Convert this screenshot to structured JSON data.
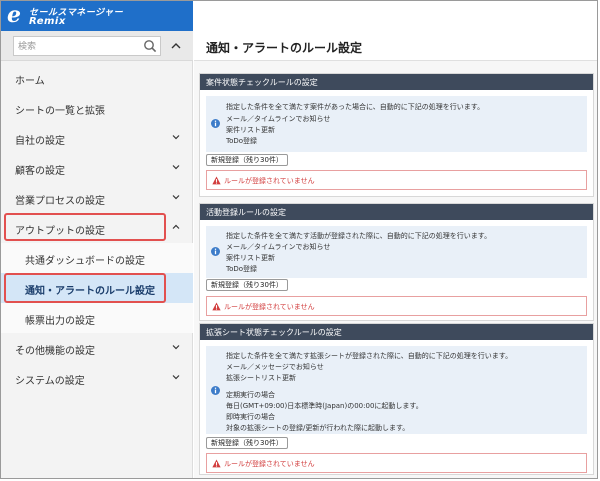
{
  "logo": {
    "line1": "セールスマネージャー",
    "line2": "Remix"
  },
  "search": {
    "placeholder": "検索"
  },
  "sidebar": {
    "items": [
      {
        "label": "ホーム"
      },
      {
        "label": "シートの一覧と拡張"
      },
      {
        "label": "自社の設定"
      },
      {
        "label": "顧客の設定"
      },
      {
        "label": "営業プロセスの設定"
      },
      {
        "label": "アウトプットの設定"
      },
      {
        "label": "共通ダッシュボードの設定"
      },
      {
        "label": "通知・アラートのルール設定"
      },
      {
        "label": "帳票出力の設定"
      },
      {
        "label": "その他機能の設定"
      },
      {
        "label": "システムの設定"
      }
    ]
  },
  "main": {
    "title": "通知・アラートのルール設定",
    "sections": [
      {
        "title": "案件状態チェックルールの設定",
        "lines": [
          "指定した条件を全て満たす案件があった場合に、自動的に下記の処理を行います。",
          "メール／タイムラインでお知らせ",
          "案件リスト更新",
          "ToDo登録"
        ],
        "button": "新規登録（残り30件）",
        "alert": "ルールが登録されていません"
      },
      {
        "title": "活動登録ルールの設定",
        "lines": [
          "指定した条件を全て満たす活動が登録された際に、自動的に下記の処理を行います。",
          "メール／タイムラインでお知らせ",
          "案件リスト更新",
          "ToDo登録"
        ],
        "button": "新規登録（残り30件）",
        "alert": "ルールが登録されていません"
      },
      {
        "title": "拡張シート状態チェックルールの設定",
        "lines": [
          "指定した条件を全て満たす拡張シートが登録された際に、自動的に下記の処理を行います。",
          "メール／メッセージでお知らせ",
          "拡張シートリスト更新",
          "定期実行の場合",
          "毎日(GMT+09:00)日本標準時(Japan)の00:00に起動します。",
          "即時実行の場合",
          "対象の拡張シートの登録/更新が行われた際に起動します。"
        ],
        "button": "新規登録（残り30件）",
        "alert": "ルールが登録されていません"
      }
    ]
  },
  "colors": {
    "brand": "#1f6fc9",
    "highlight": "#e2504f",
    "section_header": "#3e4a5c",
    "alert": "#d23d3d"
  }
}
